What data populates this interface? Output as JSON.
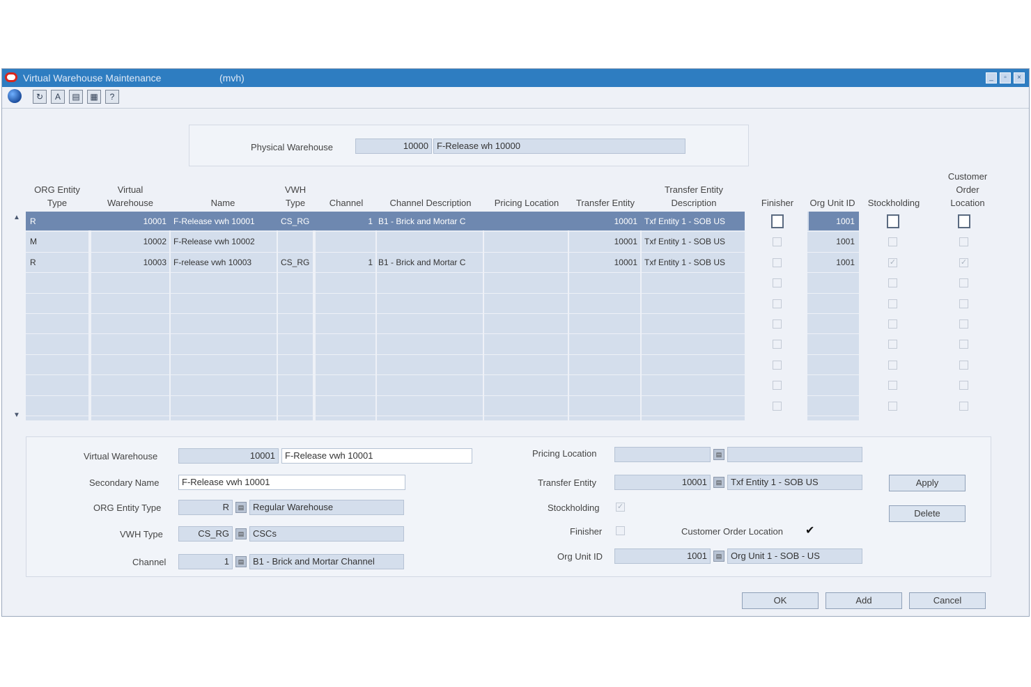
{
  "window": {
    "title": "Virtual Warehouse Maintenance",
    "code": "(mvh)"
  },
  "toolbar": {
    "icons": [
      "globe-icon",
      "refresh-icon",
      "spell-icon",
      "report-icon",
      "grid-icon",
      "help-icon"
    ]
  },
  "physical_warehouse": {
    "label": "Physical Warehouse",
    "id": "10000",
    "name": "F-Release wh 10000"
  },
  "grid": {
    "headers": {
      "org_entity_type": [
        "ORG Entity",
        "Type"
      ],
      "virtual_warehouse": [
        "Virtual",
        "Warehouse"
      ],
      "name": "Name",
      "vwh_type": [
        "VWH",
        "Type"
      ],
      "channel": "Channel",
      "channel_description": "Channel Description",
      "pricing_location": "Pricing Location",
      "transfer_entity": "Transfer Entity",
      "transfer_entity_description": [
        "Transfer Entity",
        "Description"
      ],
      "finisher": "Finisher",
      "org_unit_id": "Org Unit ID",
      "stockholding": "Stockholding",
      "customer_order_location": [
        "Customer",
        "Order",
        "Location"
      ]
    },
    "rows": [
      {
        "org_type": "R",
        "vwh": "10001",
        "name": "F-Release vwh 10001",
        "vwh_type": "CS_RG",
        "channel": "1",
        "channel_desc": "B1 - Brick and Mortar C",
        "pricing": "",
        "transfer": "10001",
        "transfer_desc": "Txf Entity 1 - SOB US",
        "finisher": false,
        "org_unit": "1001",
        "stockholding": true,
        "col": true,
        "selected": true
      },
      {
        "org_type": "M",
        "vwh": "10002",
        "name": "F-Release vwh 10002",
        "vwh_type": "",
        "channel": "",
        "channel_desc": "",
        "pricing": "",
        "transfer": "10001",
        "transfer_desc": "Txf Entity 1 - SOB US",
        "finisher": false,
        "org_unit": "1001",
        "stockholding": false,
        "col": false,
        "selected": false
      },
      {
        "org_type": "R",
        "vwh": "10003",
        "name": "F-release vwh 10003",
        "vwh_type": "CS_RG",
        "channel": "1",
        "channel_desc": "B1 - Brick and Mortar C",
        "pricing": "",
        "transfer": "10001",
        "transfer_desc": "Txf Entity 1 - SOB US",
        "finisher": false,
        "org_unit": "1001",
        "stockholding": true,
        "col": true,
        "selected": false
      }
    ]
  },
  "detail": {
    "virtual_warehouse": {
      "label": "Virtual Warehouse",
      "id": "10001",
      "name": "F-Release vwh 10001"
    },
    "secondary_name": {
      "label": "Secondary Name",
      "value": "F-Release vwh 10001"
    },
    "org_entity_type": {
      "label": "ORG Entity Type",
      "code": "R",
      "desc": "Regular Warehouse"
    },
    "vwh_type": {
      "label": "VWH Type",
      "code": "CS_RG",
      "desc": "CSCs"
    },
    "channel": {
      "label": "Channel",
      "code": "1",
      "desc": "B1 - Brick and Mortar Channel"
    },
    "pricing_location": {
      "label": "Pricing Location",
      "code": "",
      "desc": ""
    },
    "transfer_entity": {
      "label": "Transfer Entity",
      "code": "10001",
      "desc": "Txf Entity 1 - SOB US"
    },
    "stockholding": {
      "label": "Stockholding",
      "checked": true
    },
    "finisher": {
      "label": "Finisher",
      "checked": false
    },
    "customer_order_location": {
      "label": "Customer Order Location",
      "checked": true
    },
    "org_unit_id": {
      "label": "Org Unit ID",
      "code": "1001",
      "desc": "Org Unit 1 - SOB - US"
    }
  },
  "buttons": {
    "apply": "Apply",
    "delete": "Delete",
    "ok": "OK",
    "add": "Add",
    "cancel": "Cancel"
  },
  "colors": {
    "titlebar": "#2e7dc1",
    "selected_row": "#6e88b0",
    "grid_cell": "#d4deec"
  }
}
